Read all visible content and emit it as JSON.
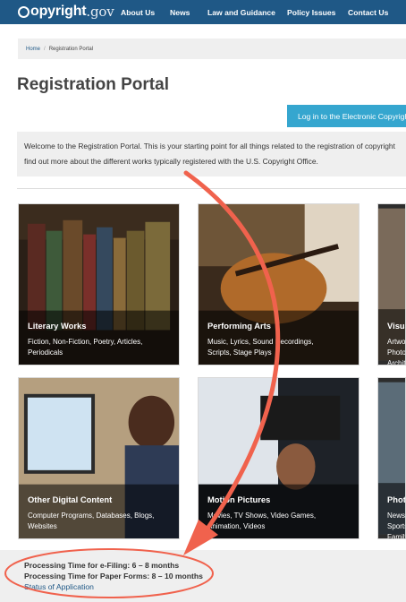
{
  "header": {
    "logo_bold": "opyright",
    "logo_thin": ".gov",
    "nav": [
      "About Us",
      "News",
      "Law and Guidance",
      "Policy Issues",
      "Contact Us"
    ]
  },
  "breadcrumb": {
    "home": "Home",
    "separator": "/",
    "current": "Registration Portal"
  },
  "page_title": "Registration Portal",
  "login_button": "Log in to the Electronic Copyright Office",
  "welcome": {
    "line1": "Welcome to the Registration Portal. This is your starting point for all things related to the registration of copyright",
    "line2": "find out more about the different works typically registered with the U.S. Copyright Office."
  },
  "categories": [
    {
      "title": "Literary Works",
      "sub1": "Fiction, Non-Fiction, Poetry, Articles,",
      "sub2": "Periodicals"
    },
    {
      "title": "Performing Arts",
      "sub1": "Music, Lyrics, Sound Recordings,",
      "sub2": "Scripts, Stage Plays"
    },
    {
      "title": "Visual Arts",
      "sub1": "Artwork, Photographs,",
      "sub2": "Architecture"
    },
    {
      "title": "Other Digital Content",
      "sub1": "Computer Programs, Databases, Blogs,",
      "sub2": "Websites"
    },
    {
      "title": "Motion Pictures",
      "sub1": "Movies, TV Shows, Video Games,",
      "sub2": "Animation, Videos"
    },
    {
      "title": "Photographs",
      "sub1": "News, Sports,",
      "sub2": "Family Photos"
    }
  ],
  "processing": {
    "efiling": "Processing Time for e-Filing: 6 – 8 months",
    "paper": "Processing Time for Paper Forms: 8 – 10 months",
    "status_link": "Status of Application"
  },
  "colors": {
    "header_bg": "#1f5886",
    "login_btn": "#35a6cf",
    "annotation": "#f0624d"
  }
}
